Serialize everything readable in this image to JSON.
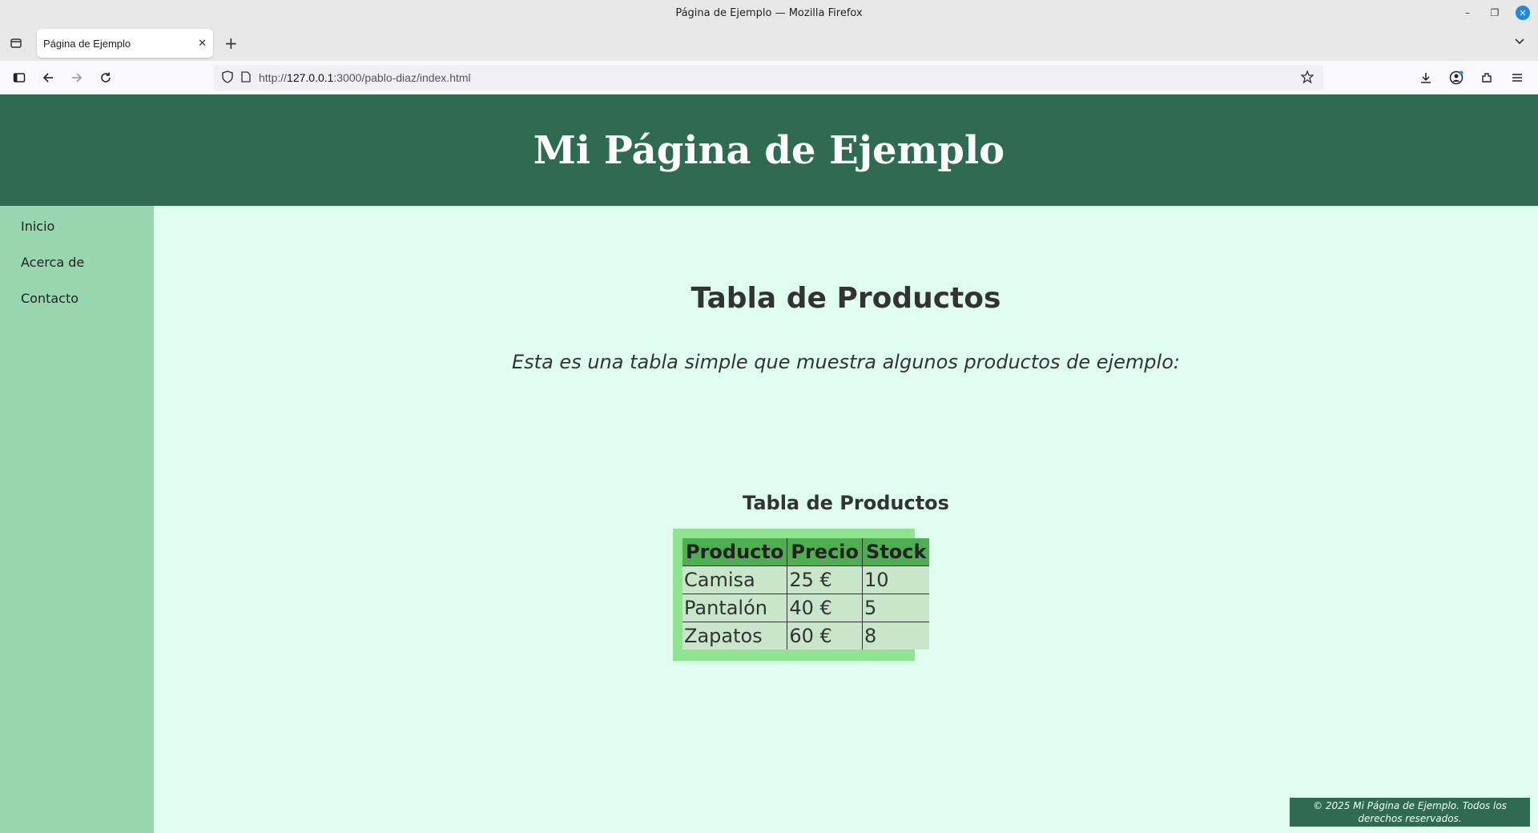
{
  "window": {
    "title": "Página de Ejemplo — Mozilla Firefox"
  },
  "tabs": [
    {
      "label": "Página de Ejemplo"
    }
  ],
  "urlbar": {
    "prefix": "http://",
    "host": "127.0.0.1",
    "rest": ":3000/pablo-diaz/index.html"
  },
  "page": {
    "header_title": "Mi Página de Ejemplo",
    "nav": [
      {
        "label": "Inicio"
      },
      {
        "label": "Acerca de"
      },
      {
        "label": "Contacto"
      }
    ],
    "heading": "Tabla de Productos",
    "intro": "Esta es una tabla simple que muestra algunos productos de ejemplo:",
    "table": {
      "caption": "Tabla de Productos",
      "headers": [
        "Producto",
        "Precio",
        "Stock"
      ],
      "rows": [
        [
          "Camisa",
          "25 €",
          "10"
        ],
        [
          "Pantalón",
          "40 €",
          "5"
        ],
        [
          "Zapatos",
          "60 €",
          "8"
        ]
      ]
    },
    "footer": "© 2025 Mi Página de Ejemplo. Todos los derechos reservados."
  },
  "colors": {
    "header_bg": "#2e6b50",
    "sidebar_bg": "#98d6b0",
    "page_bg": "#e0fef0",
    "table_frame": "#8fe58f",
    "table_header_bg": "#4caf50",
    "table_cell_bg": "#c8e6c9"
  }
}
